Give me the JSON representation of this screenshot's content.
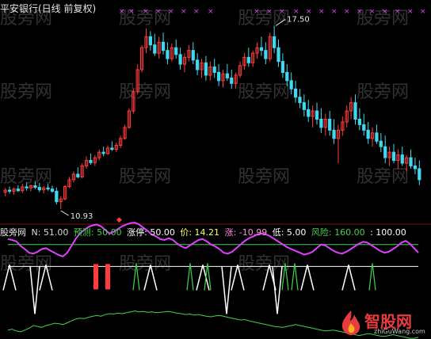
{
  "header": {
    "title": "平安银行(日线 前复权)"
  },
  "price_panel": {
    "high_label": "17.50",
    "low_label": "10.93"
  },
  "indicator_bar": {
    "name": "股旁网",
    "n": "N: 51.00",
    "pred": "预测: 50.00",
    "zt": "涨停: 50.00",
    "jia": "价: 14.21",
    "zhang": "涨: -10.99",
    "di": "低: 5.00",
    "fx": "风险: 160.00",
    "tail": ": 100.00"
  },
  "watermarks": [
    "股旁网",
    "股旁网",
    "股旁网",
    "股旁网",
    "股旁网",
    "股旁网",
    "股旁网",
    "股旁网",
    "股旁网",
    "股旁网",
    "股旁网",
    "股旁网",
    "股旁网",
    "股旁网",
    "股旁网"
  ],
  "logo": {
    "text": "智股网",
    "sub": "zhiGuWang.com"
  },
  "colors": {
    "up": "#ff3c3c",
    "down": "#3fd9f0",
    "magenta": "#e040ff",
    "green": "#3fd34b",
    "white": "#ffffff",
    "star": "#e040ff",
    "ref_green": "#3fd34b"
  },
  "chart_data": [
    {
      "type": "candlestick",
      "title": "平安银行(日线 前复权)",
      "annotations": [
        {
          "label": "17.50",
          "kind": "high"
        },
        {
          "label": "10.93",
          "kind": "low"
        }
      ],
      "ohlc": [
        [
          11.55,
          11.7,
          11.4,
          11.62
        ],
        [
          11.62,
          11.75,
          11.5,
          11.58
        ],
        [
          11.58,
          11.72,
          11.45,
          11.66
        ],
        [
          11.66,
          11.8,
          11.55,
          11.6
        ],
        [
          11.6,
          11.85,
          11.52,
          11.74
        ],
        [
          11.74,
          11.9,
          11.6,
          11.7
        ],
        [
          11.7,
          11.82,
          11.58,
          11.78
        ],
        [
          11.78,
          11.95,
          11.66,
          11.72
        ],
        [
          11.72,
          11.88,
          11.55,
          11.63
        ],
        [
          11.63,
          11.76,
          11.5,
          11.7
        ],
        [
          11.7,
          11.85,
          11.6,
          11.66
        ],
        [
          11.66,
          11.78,
          11.52,
          11.58
        ],
        [
          11.58,
          11.72,
          11.1,
          11.2
        ],
        [
          11.2,
          11.4,
          10.93,
          11.3
        ],
        [
          11.3,
          11.8,
          11.25,
          11.75
        ],
        [
          11.75,
          12.1,
          11.7,
          12.0
        ],
        [
          12.0,
          12.3,
          11.9,
          12.2
        ],
        [
          12.2,
          12.45,
          12.05,
          12.1
        ],
        [
          12.1,
          12.6,
          12.05,
          12.5
        ],
        [
          12.5,
          12.85,
          12.4,
          12.7
        ],
        [
          12.7,
          12.95,
          12.55,
          12.62
        ],
        [
          12.62,
          12.9,
          12.5,
          12.8
        ],
        [
          12.8,
          13.1,
          12.7,
          13.0
        ],
        [
          13.0,
          13.2,
          12.85,
          12.95
        ],
        [
          12.95,
          13.25,
          12.9,
          13.15
        ],
        [
          13.15,
          13.4,
          13.05,
          13.1
        ],
        [
          13.1,
          13.35,
          13.0,
          13.25
        ],
        [
          13.25,
          13.6,
          13.15,
          13.5
        ],
        [
          13.5,
          14.0,
          13.45,
          13.9
        ],
        [
          13.9,
          14.6,
          13.85,
          14.5
        ],
        [
          14.5,
          15.3,
          14.4,
          15.2
        ],
        [
          15.2,
          16.2,
          15.1,
          16.0
        ],
        [
          16.0,
          16.9,
          15.9,
          16.8
        ],
        [
          16.8,
          17.5,
          16.6,
          17.2
        ],
        [
          17.2,
          17.4,
          16.7,
          16.9
        ],
        [
          16.9,
          17.3,
          16.5,
          16.6
        ],
        [
          16.6,
          17.2,
          16.4,
          17.0
        ],
        [
          17.0,
          17.35,
          16.55,
          16.7
        ],
        [
          16.7,
          17.0,
          16.2,
          16.4
        ],
        [
          16.4,
          16.95,
          16.3,
          16.8
        ],
        [
          16.8,
          17.1,
          16.4,
          16.55
        ],
        [
          16.55,
          16.8,
          16.0,
          16.2
        ],
        [
          16.2,
          16.6,
          15.9,
          16.45
        ],
        [
          16.45,
          16.9,
          16.3,
          16.7
        ],
        [
          16.7,
          17.0,
          16.2,
          16.35
        ],
        [
          16.35,
          16.6,
          15.8,
          16.0
        ],
        [
          16.0,
          16.4,
          15.7,
          16.25
        ],
        [
          16.25,
          16.5,
          15.6,
          15.8
        ],
        [
          15.8,
          16.3,
          15.6,
          16.1
        ],
        [
          16.1,
          16.4,
          15.7,
          15.9
        ],
        [
          15.9,
          16.2,
          15.4,
          15.6
        ],
        [
          15.6,
          16.0,
          15.35,
          15.85
        ],
        [
          15.85,
          16.2,
          15.6,
          15.7
        ],
        [
          15.7,
          16.0,
          15.3,
          15.5
        ],
        [
          15.5,
          15.9,
          15.3,
          15.8
        ],
        [
          15.8,
          16.3,
          15.7,
          16.15
        ],
        [
          16.15,
          16.6,
          16.0,
          16.45
        ],
        [
          16.45,
          16.8,
          16.1,
          16.25
        ],
        [
          16.25,
          16.7,
          16.1,
          16.6
        ],
        [
          16.6,
          17.0,
          16.4,
          16.8
        ],
        [
          16.8,
          17.2,
          16.5,
          16.7
        ],
        [
          16.7,
          17.0,
          16.2,
          16.4
        ],
        [
          16.4,
          17.35,
          16.3,
          17.2
        ],
        [
          17.2,
          17.6,
          16.6,
          16.8
        ],
        [
          16.8,
          17.1,
          16.1,
          16.3
        ],
        [
          16.3,
          16.6,
          15.7,
          15.9
        ],
        [
          15.9,
          16.2,
          15.4,
          15.6
        ],
        [
          15.6,
          15.9,
          15.1,
          15.3
        ],
        [
          15.3,
          15.6,
          14.8,
          15.0
        ],
        [
          15.0,
          15.3,
          14.6,
          14.8
        ],
        [
          14.8,
          15.1,
          14.3,
          14.55
        ],
        [
          14.55,
          14.9,
          14.1,
          14.3
        ],
        [
          14.3,
          14.7,
          13.9,
          14.5
        ],
        [
          14.5,
          14.8,
          14.0,
          14.2
        ],
        [
          14.2,
          14.6,
          13.7,
          13.9
        ],
        [
          13.9,
          14.4,
          13.6,
          14.2
        ],
        [
          14.2,
          14.5,
          13.6,
          13.8
        ],
        [
          13.8,
          14.2,
          13.3,
          13.5
        ],
        [
          13.5,
          14.0,
          12.6,
          13.8
        ],
        [
          13.8,
          14.3,
          13.6,
          14.1
        ],
        [
          14.1,
          14.7,
          13.9,
          14.5
        ],
        [
          14.5,
          15.0,
          14.2,
          14.8
        ],
        [
          14.8,
          15.1,
          14.0,
          14.2
        ],
        [
          14.2,
          14.6,
          13.8,
          14.0
        ],
        [
          14.0,
          14.4,
          13.6,
          13.8
        ],
        [
          13.8,
          14.1,
          13.3,
          13.5
        ],
        [
          13.5,
          13.9,
          13.2,
          13.7
        ],
        [
          13.7,
          14.0,
          13.3,
          13.4
        ],
        [
          13.4,
          13.7,
          13.0,
          13.2
        ],
        [
          13.2,
          13.6,
          12.6,
          12.8
        ],
        [
          12.8,
          13.2,
          12.5,
          13.0
        ],
        [
          13.0,
          13.3,
          12.6,
          12.7
        ],
        [
          12.7,
          13.1,
          12.4,
          12.9
        ],
        [
          12.9,
          13.2,
          12.5,
          12.6
        ],
        [
          12.6,
          12.9,
          12.3,
          12.8
        ],
        [
          12.8,
          13.1,
          12.4,
          12.5
        ],
        [
          12.5,
          12.8,
          12.2,
          12.4
        ],
        [
          12.4,
          12.7,
          11.8,
          12.0
        ]
      ]
    },
    {
      "type": "line",
      "series": [
        {
          "values": [
            60,
            58,
            55,
            45,
            38,
            30,
            28,
            32,
            38,
            40,
            35,
            30,
            25,
            22,
            30,
            45,
            60,
            72,
            80,
            86,
            90,
            92,
            88,
            80,
            72,
            76,
            82,
            88,
            92,
            95,
            96,
            92,
            85,
            78,
            70,
            66,
            60,
            58,
            62,
            58,
            50,
            44,
            40,
            46,
            52,
            58,
            60,
            55,
            48,
            44,
            38,
            30,
            28,
            32,
            40,
            48,
            56,
            62,
            66,
            70,
            72,
            70,
            66,
            60,
            54,
            48,
            42,
            38,
            34,
            30,
            26,
            28,
            32,
            40,
            48,
            46,
            40,
            34,
            30,
            28,
            32,
            38,
            44,
            50,
            54,
            52,
            46,
            40,
            34,
            30,
            32,
            38,
            44,
            52,
            56,
            50,
            40,
            30
          ]
        },
        {
          "values": [
            -70,
            -68,
            -72,
            -74,
            -70,
            -66,
            -60,
            -62,
            -64,
            -60,
            -58,
            -55,
            -56,
            -58,
            -54,
            -50,
            -46,
            -44,
            -45,
            -42,
            -40,
            -38,
            -40,
            -36,
            -34,
            -35,
            -33,
            -34,
            -32,
            -30,
            -28,
            -30,
            -29,
            -31,
            -30,
            -32,
            -31,
            -30,
            -29,
            -31,
            -33,
            -34,
            -36,
            -35,
            -37,
            -36,
            -38,
            -40,
            -41,
            -39,
            -38,
            -40,
            -42,
            -44,
            -46,
            -48,
            -47,
            -50,
            -52,
            -54,
            -56,
            -58,
            -60,
            -62,
            -63,
            -64,
            -62,
            -60,
            -58,
            -60,
            -62,
            -64,
            -66,
            -68,
            -70,
            -72,
            -71,
            -70,
            -72,
            -74,
            -76,
            -78,
            -80,
            -82,
            -80,
            -78,
            -79,
            -81,
            -83,
            -84,
            -82,
            -80,
            -82,
            -84,
            -86,
            -88,
            -88,
            -86
          ]
        }
      ],
      "reference_lines": [
        100,
        0
      ]
    }
  ]
}
